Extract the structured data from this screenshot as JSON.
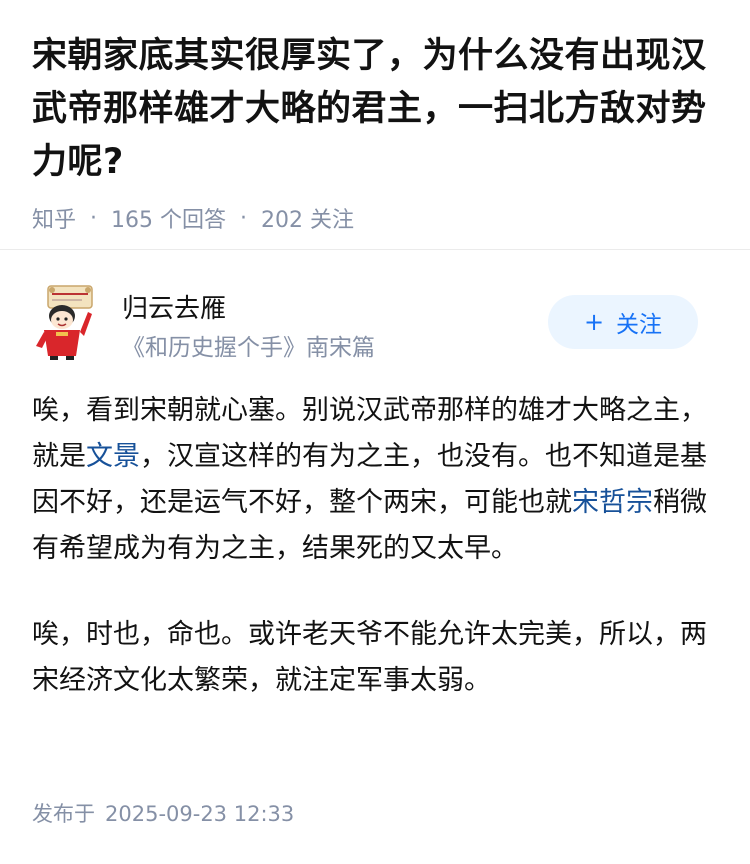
{
  "question": {
    "title": "宋朝家底其实很厚实了，为什么没有出现汉武帝那样雄才大略的君主，一扫北方敌对势力呢?",
    "source": "知乎",
    "answers_count": "165",
    "answers_label": "个回答",
    "followers_count": "202",
    "followers_label": "关注"
  },
  "author": {
    "name": "归云去雁",
    "bio": "《和历史握个手》南宋篇",
    "follow_label": "关注",
    "avatar_icon": "cartoon-avatar-icon"
  },
  "answer": {
    "p1_a": "唉，看到宋朝就心塞。别说汉武帝那样的雄才大略之主，就是",
    "link1": "文景",
    "p1_b": "，汉宣这样的有为之主，也没有。也不知道是基因不好，还是运气不好，整个两宋，可能也就",
    "link2": "宋哲宗",
    "p1_c": "稍微有希望成为有为之主，结果死的又太早。",
    "p2": "唉，时也，命也。或许老天爷不能允许太完美，所以，两宋经济文化太繁荣，就注定军事太弱。"
  },
  "footer": {
    "publish_label": "发布于",
    "publish_time": "2025-09-23 12:33"
  },
  "colors": {
    "link": "#175199",
    "accent": "#1772f6",
    "meta": "#8590a6",
    "follow_bg": "#ebf5ff"
  }
}
